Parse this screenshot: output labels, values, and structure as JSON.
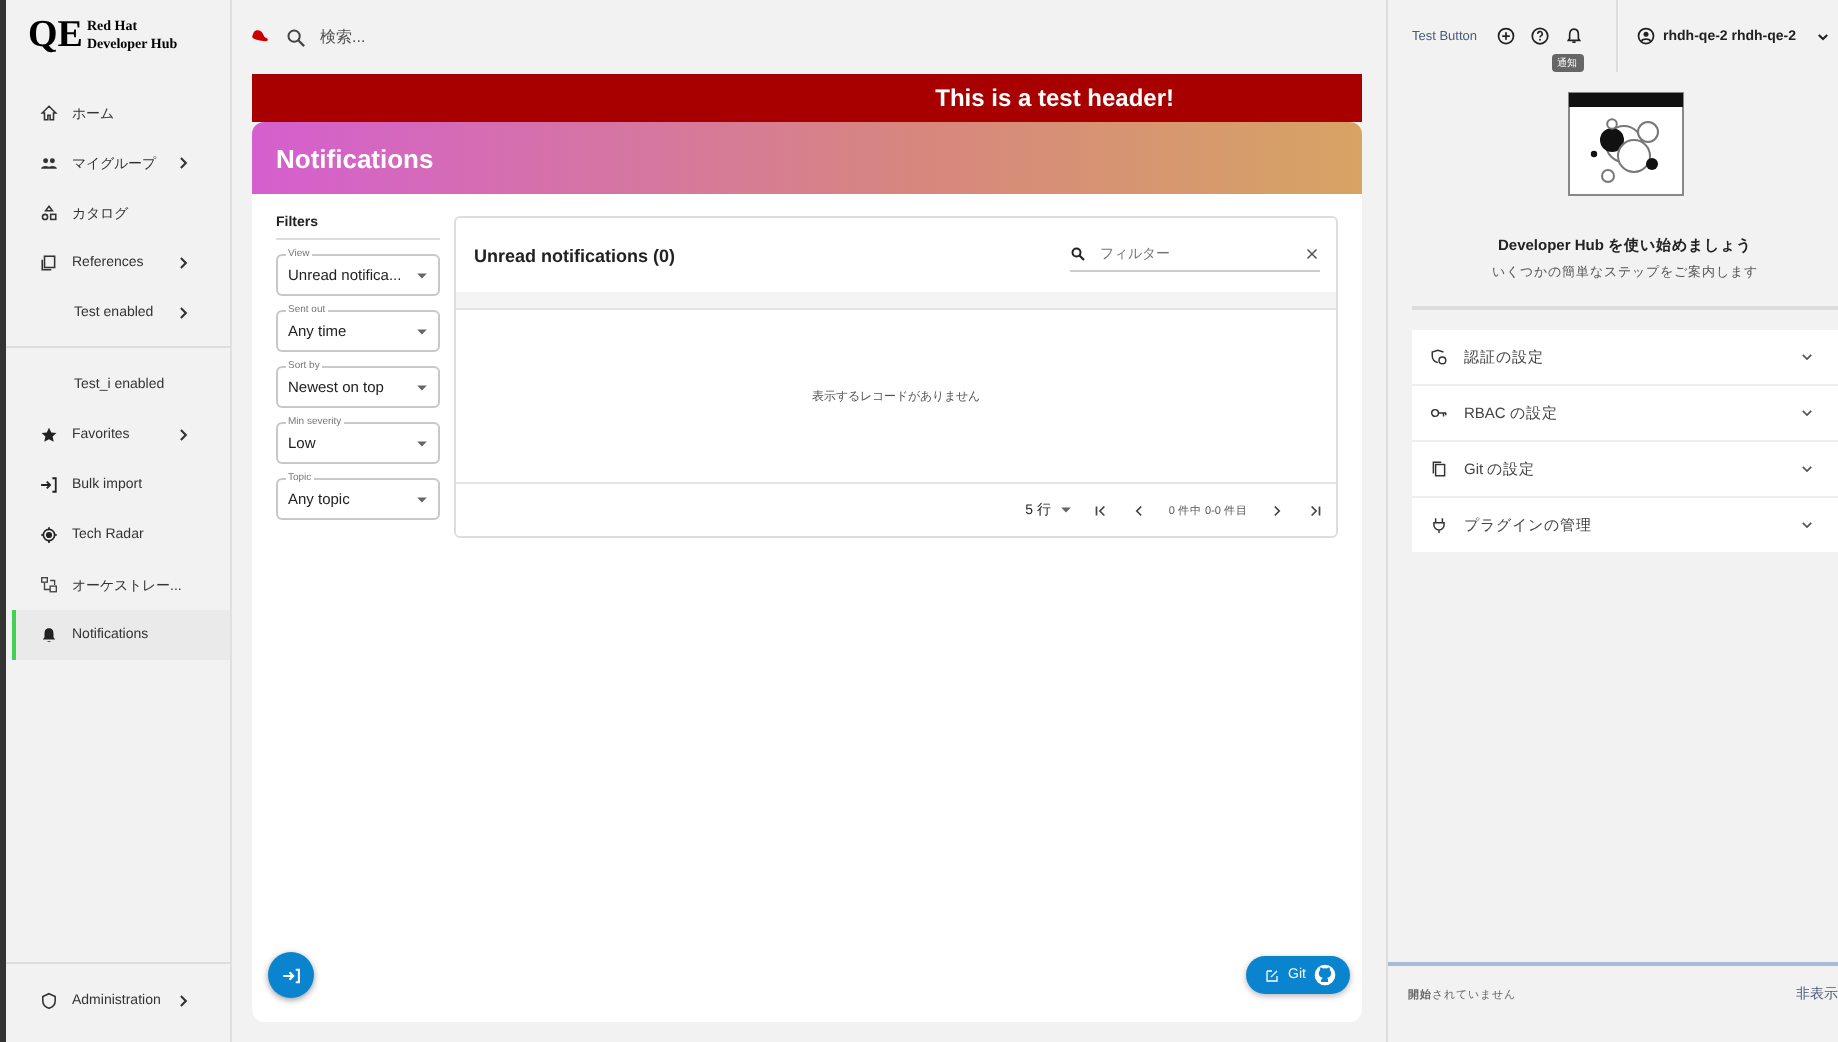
{
  "brand": {
    "mark": "QE",
    "line1": "Red Hat",
    "line2": "Developer Hub"
  },
  "sidebar": {
    "items": [
      {
        "kind": "link",
        "label": "ホーム",
        "expandable": false,
        "selected": false
      },
      {
        "kind": "link",
        "label": "マイグループ",
        "expandable": true,
        "selected": false
      },
      {
        "kind": "link",
        "label": "カタログ",
        "expandable": false,
        "selected": false
      },
      {
        "kind": "link",
        "label": "References",
        "expandable": true,
        "selected": false
      },
      {
        "kind": "sub",
        "label": "Test enabled",
        "expandable": true,
        "selected": false
      },
      {
        "kind": "divider"
      },
      {
        "kind": "sub",
        "label": "Test_i enabled",
        "expandable": false,
        "selected": false
      },
      {
        "kind": "link",
        "label": "Favorites",
        "expandable": true,
        "selected": false
      },
      {
        "kind": "link",
        "label": "Bulk import",
        "expandable": false,
        "selected": false
      },
      {
        "kind": "link",
        "label": "Tech Radar",
        "expandable": false,
        "selected": false
      },
      {
        "kind": "link",
        "label": "オーケストレー...",
        "expandable": false,
        "selected": false
      },
      {
        "kind": "link",
        "label": "Notifications",
        "expandable": false,
        "selected": true
      }
    ],
    "footer": {
      "label": "Administration",
      "expandable": true
    }
  },
  "topbar": {
    "search": {
      "placeholder": "検索..."
    },
    "test_button": "Test Button",
    "tooltip": "通知",
    "user": "rhdh-qe-2 rhdh-qe-2"
  },
  "banner": "This is a test header!",
  "page_title": "Notifications",
  "filters": {
    "title": "Filters",
    "fields": [
      {
        "label": "View",
        "value": "Unread notifica..."
      },
      {
        "label": "Sent out",
        "value": "Any time"
      },
      {
        "label": "Sort by",
        "value": "Newest on top"
      },
      {
        "label": "Min severity",
        "value": "Low"
      },
      {
        "label": "Topic",
        "value": "Any topic"
      }
    ]
  },
  "table": {
    "title": "Unread notifications (0)",
    "filter": {
      "placeholder": "フィルター"
    },
    "empty": "表示するレコードがありません",
    "rows_per_page": "5 行",
    "range": "0 件中 0-0 件目"
  },
  "git_button": "Git",
  "quickstart": {
    "title": "Developer Hub を使い始めましょう",
    "subtitle": "いくつかの簡単なステップをご案内します",
    "sections": [
      {
        "label": "認証の設定",
        "expanded": false
      },
      {
        "label": "RBAC の設定",
        "expanded": false
      },
      {
        "label": "Git の設定",
        "expanded": false
      },
      {
        "label": "プラグインの管理",
        "expanded": false
      }
    ],
    "status": "**開始**されていません",
    "hide": "非表示"
  }
}
